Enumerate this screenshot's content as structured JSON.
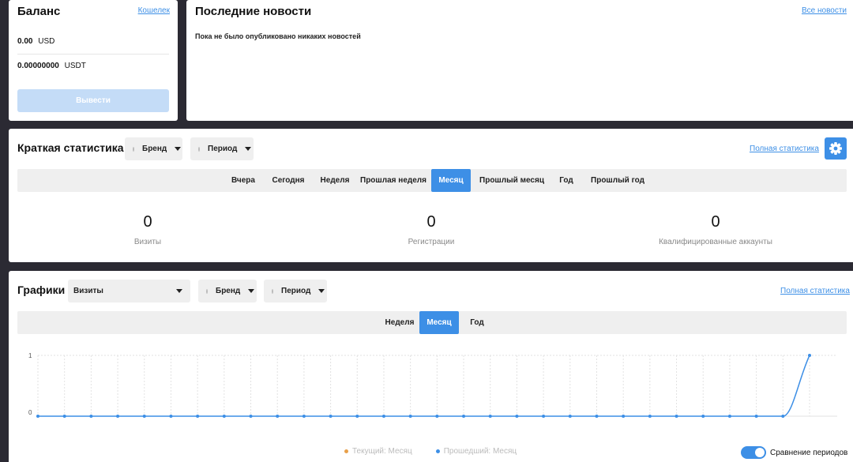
{
  "balance": {
    "title": "Баланс",
    "wallet_link": "Кошелек",
    "rows": [
      {
        "amount": "0.00",
        "currency": "USD"
      },
      {
        "amount": "0.00000000",
        "currency": "USDT"
      }
    ],
    "withdraw_label": "Вывести"
  },
  "news": {
    "title": "Последние новости",
    "all_link": "Все новости",
    "empty_text": "Пока не было опубликовано никаких новостей"
  },
  "stats": {
    "title": "Краткая статистика",
    "brand_label": "Бренд",
    "period_label": "Период",
    "full_link": "Полная статистика",
    "tabs": [
      "Вчера",
      "Сегодня",
      "Неделя",
      "Прошлая неделя",
      "Месяц",
      "Прошлый месяц",
      "Год",
      "Прошлый год"
    ],
    "active_tab": "Месяц",
    "metrics": [
      {
        "value": "0",
        "label": "Визиты"
      },
      {
        "value": "0",
        "label": "Регистрации"
      },
      {
        "value": "0",
        "label": "Квалифицированные аккаунты"
      }
    ]
  },
  "charts": {
    "title": "Графики",
    "metric_select": "Визиты",
    "brand_label": "Бренд",
    "period_label": "Период",
    "full_link": "Полная статистика",
    "tabs": [
      "Неделя",
      "Месяц",
      "Год"
    ],
    "active_tab": "Месяц",
    "legend_current": "Текущий: Месяц",
    "legend_previous": "Прошедший: Месяц",
    "compare_label": "Сравнение периодов",
    "compare_on": true,
    "colors": {
      "current": "#e8a04a",
      "previous": "#3d8fe6",
      "accent": "#3d8fe6"
    }
  },
  "chart_data": {
    "type": "line",
    "title": "",
    "xlabel": "",
    "ylabel": "",
    "ylim": [
      0,
      1
    ],
    "yticks": [
      "0",
      "1"
    ],
    "x": [
      1,
      2,
      3,
      4,
      5,
      6,
      7,
      8,
      9,
      10,
      11,
      12,
      13,
      14,
      15,
      16,
      17,
      18,
      19,
      20,
      21,
      22,
      23,
      24,
      25,
      26,
      27,
      28,
      29,
      30
    ],
    "series": [
      {
        "name": "Прошедший: Месяц",
        "values": [
          0,
          0,
          0,
          0,
          0,
          0,
          0,
          0,
          0,
          0,
          0,
          0,
          0,
          0,
          0,
          0,
          0,
          0,
          0,
          0,
          0,
          0,
          0,
          0,
          0,
          0,
          0,
          0,
          0,
          1
        ]
      }
    ],
    "grid": true,
    "legend": "bottom-center"
  }
}
